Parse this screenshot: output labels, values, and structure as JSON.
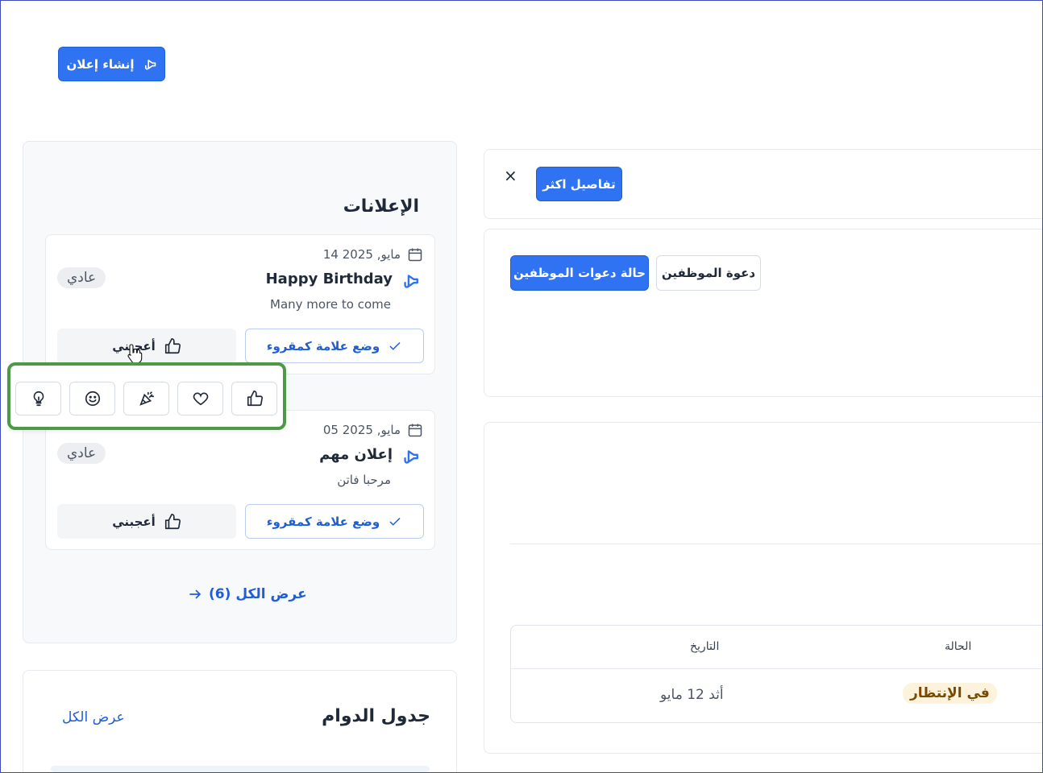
{
  "header": {
    "create_label": "إنشاء إعلان"
  },
  "announcements": {
    "title": "الإعلانات",
    "items": [
      {
        "date": "14 مايو, 2025",
        "name": "Happy Birthday",
        "desc": "Many more to come",
        "badge": "عادي",
        "mark_label": "وضع علامة كمقروء",
        "like_label": "أعجبني"
      },
      {
        "date": "05 مايو, 2025",
        "name": "إعلان مهم",
        "desc": "مرحبا فاتن",
        "badge": "عادي",
        "mark_label": "وضع علامة كمقروء",
        "like_label": "أعجبني"
      }
    ],
    "view_all_label": "عرض الكل (6)"
  },
  "reactions": [
    "thumbs-up",
    "heart",
    "party-popper",
    "smiley",
    "lightbulb"
  ],
  "schedule": {
    "title": "جدول الدوام",
    "view_all_label": "عرض الكل"
  },
  "details": {
    "button_label": "تفاصيل اكثر",
    "close_label": "×"
  },
  "invites": {
    "tab_status": "حالة دعوات الموظفين",
    "tab_invite": "دعوة الموظفين"
  },
  "table": {
    "headers": {
      "status": "الحالة",
      "date": "التاريخ"
    },
    "rows": [
      {
        "status": "في الإنتظار",
        "date": "أثد 12 مايو"
      }
    ]
  },
  "colors": {
    "primary": "#2f73f2",
    "highlight": "#4c9a46",
    "pending_bg": "#fdf3dc"
  }
}
